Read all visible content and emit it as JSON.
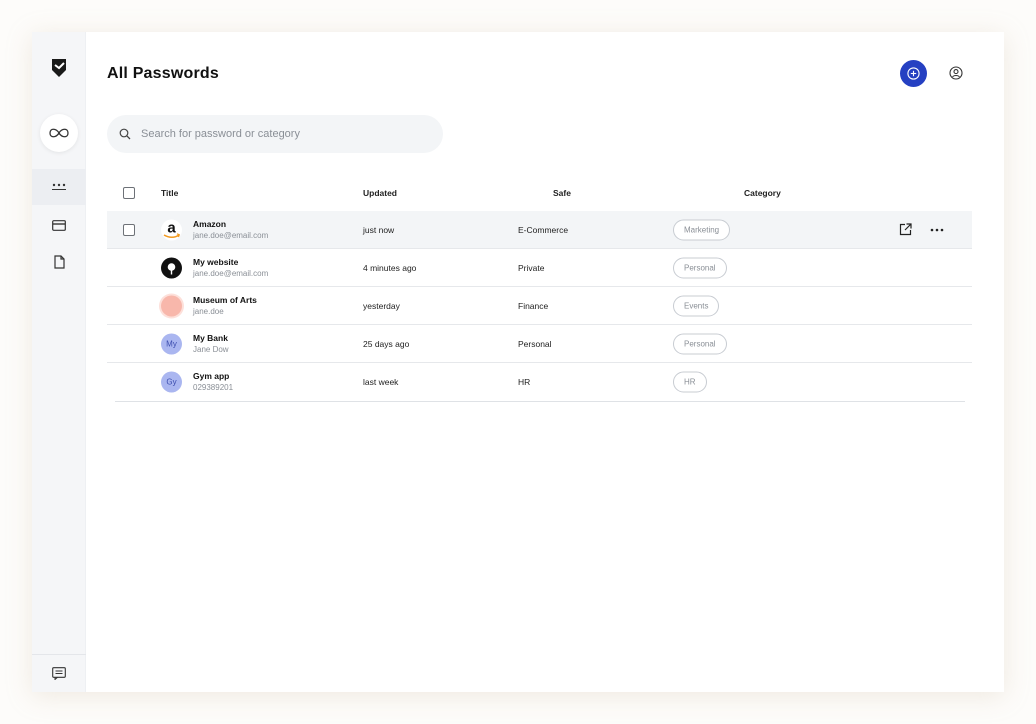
{
  "header": {
    "title": "All Passwords"
  },
  "search": {
    "placeholder": "Search for password or category"
  },
  "table": {
    "columns": {
      "title": "Title",
      "updated": "Updated",
      "safe": "Safe",
      "category": "Category"
    },
    "rows": [
      {
        "title": "Amazon",
        "subtitle": "jane.doe@email.com",
        "updated": "just now",
        "safe": "E-Commerce",
        "category": "Marketing",
        "icon": "amazon-logo",
        "avatar_text": "a"
      },
      {
        "title": "My website",
        "subtitle": "jane.doe@email.com",
        "updated": "4 minutes ago",
        "safe": "Private",
        "category": "Personal",
        "icon": "website-logo"
      },
      {
        "title": "Museum of Arts",
        "subtitle": "jane.doe",
        "updated": "yesterday",
        "safe": "Finance",
        "category": "Events",
        "icon": "museum-logo"
      },
      {
        "title": "My Bank",
        "subtitle": "Jane Dow",
        "updated": "25 days ago",
        "safe": "Personal",
        "category": "Personal",
        "avatar_text": "My"
      },
      {
        "title": "Gym app",
        "subtitle": "029389201",
        "updated": "last week",
        "safe": "HR",
        "category": "HR",
        "avatar_text": "Gy"
      }
    ]
  },
  "colors": {
    "accent": "#2540c2",
    "avatar_bg": "#aab6f0",
    "museum": "#f8b7ab"
  }
}
